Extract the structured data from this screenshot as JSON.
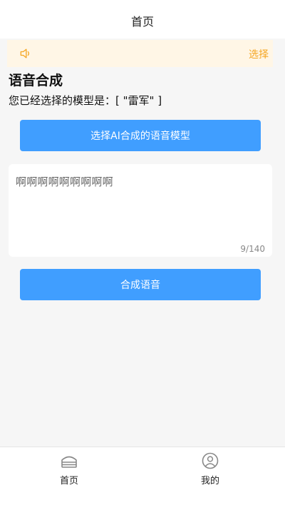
{
  "navbar": {
    "title": "首页"
  },
  "notice": {
    "text": "选择",
    "icon": "volume-icon",
    "color": "#f5a623",
    "background": "#fff6e6"
  },
  "main": {
    "heading": "语音合成",
    "selected_model_line": "您已经选择的模型是：[ \"雷军\" ]",
    "select_model_button": "选择AI合成的语音模型",
    "textarea": {
      "value": "啊啊啊啊啊啊啊啊啊",
      "counter": "9/140"
    },
    "synthesize_button": "合成语音"
  },
  "tabbar": {
    "items": [
      {
        "label": "首页",
        "icon": "home-icon"
      },
      {
        "label": "我的",
        "icon": "profile-icon"
      }
    ]
  },
  "colors": {
    "primary_button": "#409eff",
    "page_bg": "#f6f6f6"
  }
}
